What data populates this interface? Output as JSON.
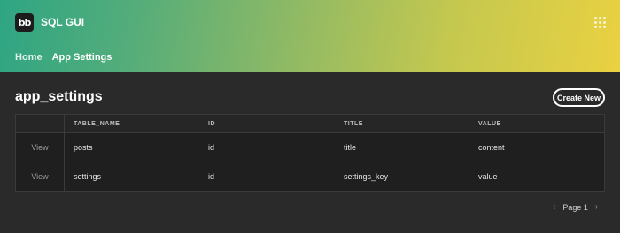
{
  "app": {
    "logo_text": "bb",
    "name": "SQL GUI"
  },
  "nav": {
    "items": [
      {
        "label": "Home"
      },
      {
        "label": "App Settings"
      }
    ]
  },
  "page": {
    "title": "app_settings",
    "create_label": "Create New"
  },
  "table": {
    "columns": [
      "",
      "TABLE_NAME",
      "ID",
      "TITLE",
      "VALUE"
    ],
    "rows": [
      {
        "action": "View",
        "table_name": "posts",
        "id": "id",
        "title": "title",
        "value": "content"
      },
      {
        "action": "View",
        "table_name": "settings",
        "id": "id",
        "title": "settings_key",
        "value": "value"
      }
    ]
  },
  "pagination": {
    "label": "Page 1",
    "prev_icon": "chevron-left-icon",
    "next_icon": "chevron-right-icon"
  },
  "colors": {
    "gradient_start": "#2ea583",
    "gradient_end": "#ead141",
    "background": "#2a2a2a"
  }
}
